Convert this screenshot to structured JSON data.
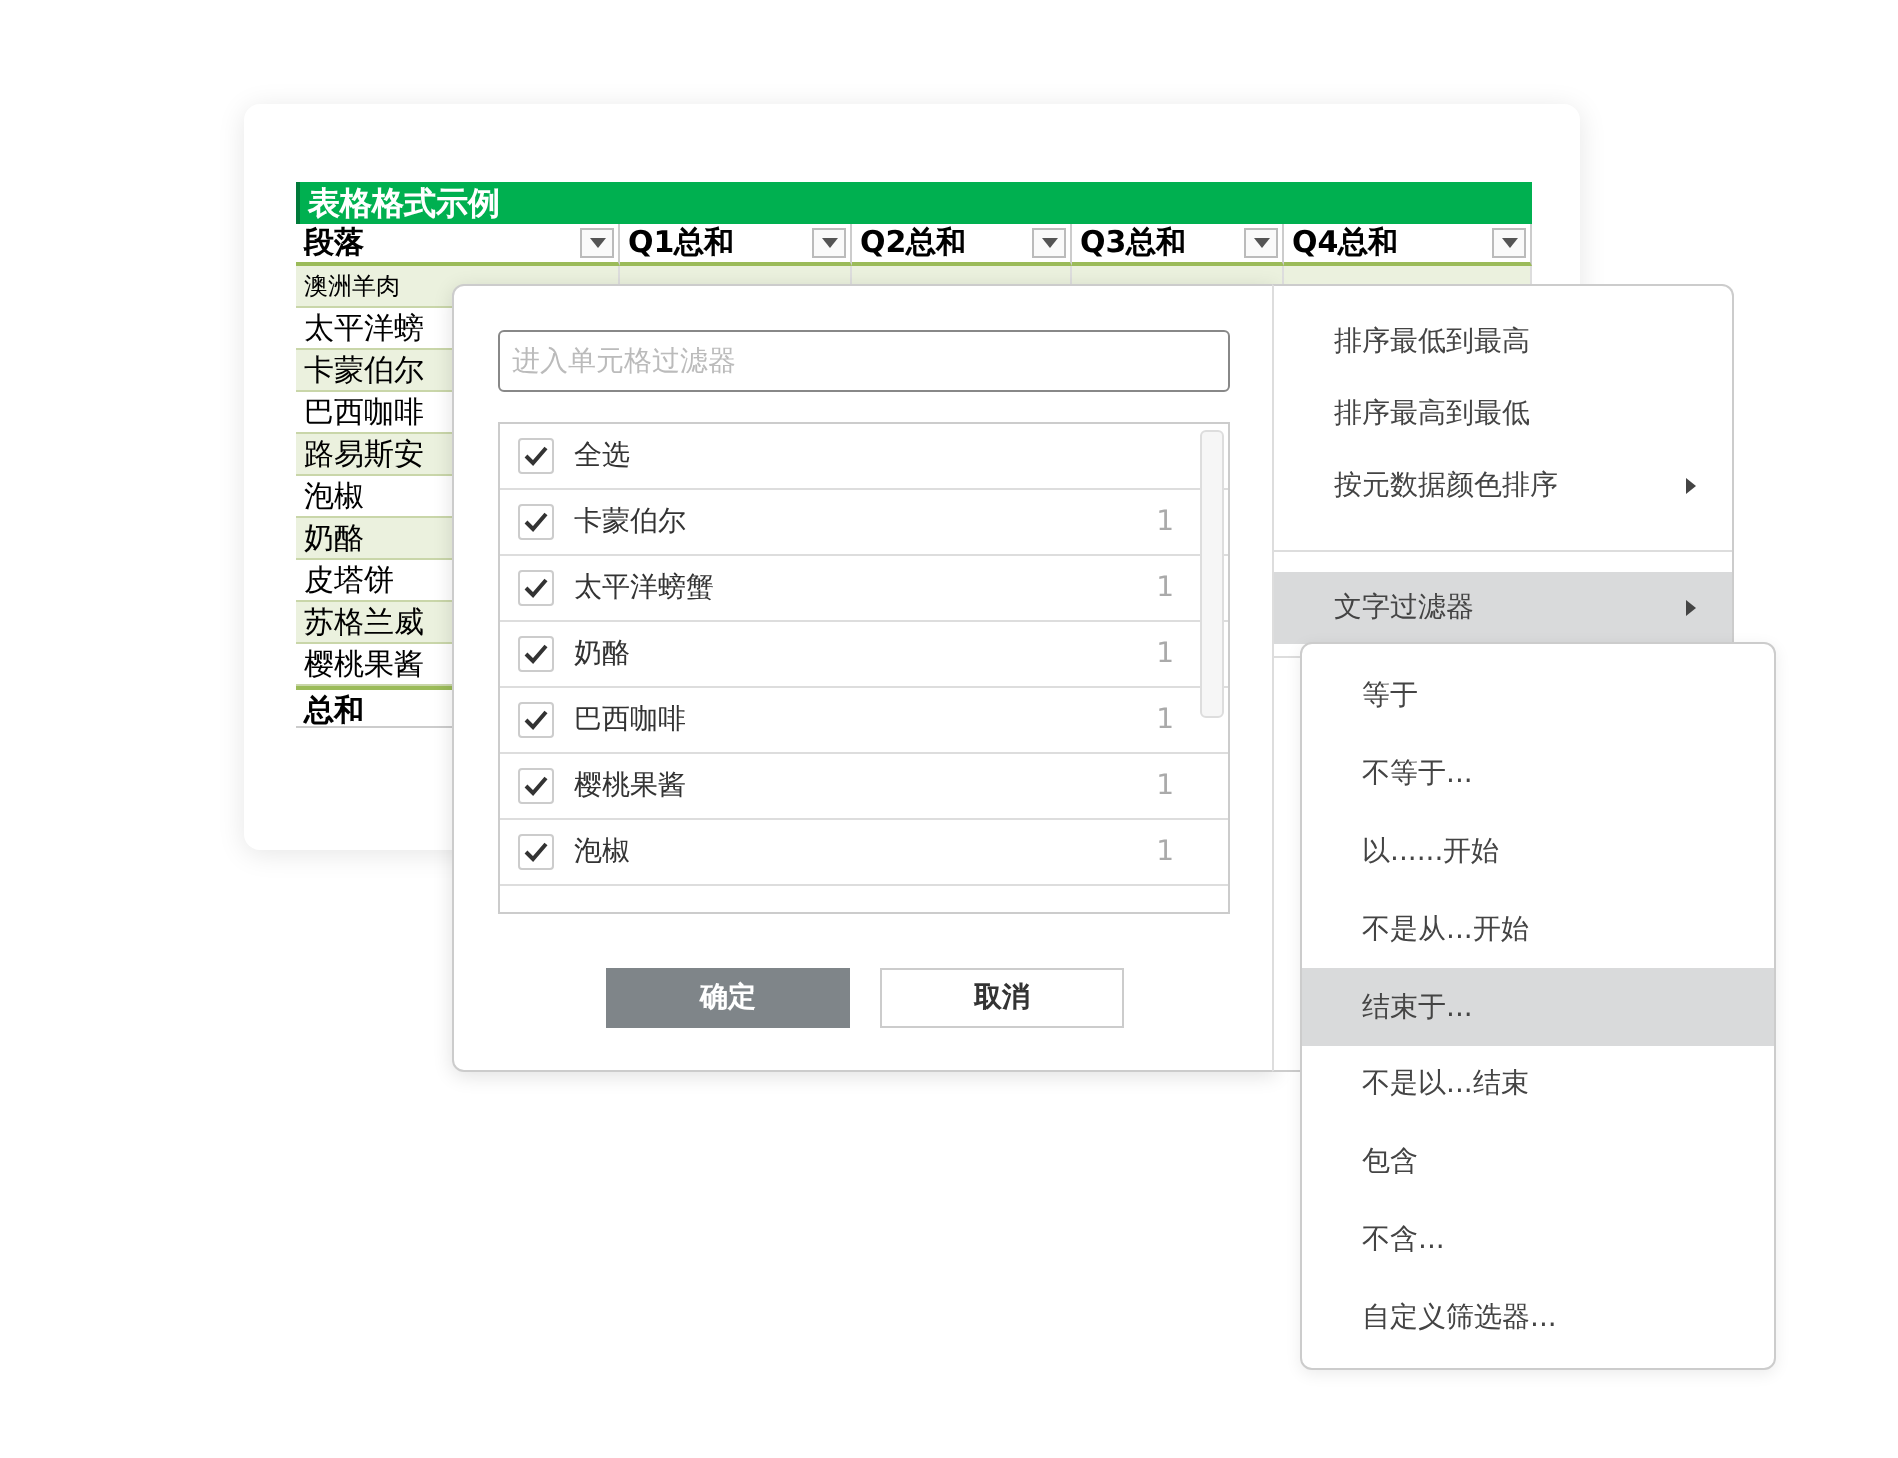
{
  "sheet": {
    "title": "表格格式示例",
    "columns": [
      "段落",
      "Q1总和",
      "Q2总和",
      "Q3总和",
      "Q4总和"
    ],
    "rows": [
      "澳洲羊肉",
      "太平洋螃",
      "卡蒙伯尔",
      "巴西咖啡",
      "路易斯安",
      "泡椒",
      "奶酪",
      "皮塔饼",
      "苏格兰威",
      "樱桃果酱"
    ],
    "total": "总和"
  },
  "filter": {
    "search": {
      "placeholder": "进入单元格过滤器"
    },
    "items": [
      {
        "label": "全选",
        "checked": true
      },
      {
        "label": "卡蒙伯尔",
        "count": "1",
        "checked": true
      },
      {
        "label": "太平洋螃蟹",
        "count": "1",
        "checked": true
      },
      {
        "label": "奶酪",
        "count": "1",
        "checked": true
      },
      {
        "label": "巴西咖啡",
        "count": "1",
        "checked": true
      },
      {
        "label": "樱桃果酱",
        "count": "1",
        "checked": true
      },
      {
        "label": "泡椒",
        "count": "1",
        "checked": true
      }
    ],
    "buttons": [
      {
        "label": "确定",
        "kind": "primary"
      },
      {
        "label": "取消",
        "kind": "secondary"
      }
    ]
  },
  "sort_menu": {
    "groups": [
      [
        {
          "label": "排序最低到最高",
          "submenu": false,
          "selected": false
        },
        {
          "label": "排序最高到最低",
          "submenu": false,
          "selected": false
        },
        {
          "label": "按元数据颜色排序",
          "submenu": true,
          "selected": false
        }
      ],
      [
        {
          "label": "文字过滤器",
          "submenu": true,
          "selected": true
        }
      ]
    ]
  },
  "text_filter_menu": {
    "items": [
      {
        "label": "等于",
        "selected": false
      },
      {
        "label": "不等于...",
        "selected": false
      },
      {
        "label": "以......开始",
        "selected": false
      },
      {
        "label": "不是从...开始",
        "selected": false
      },
      {
        "label": "结束于...",
        "selected": true
      },
      {
        "label": "不是以...结束",
        "selected": false
      },
      {
        "label": "包含",
        "selected": false
      },
      {
        "label": "不含...",
        "selected": false
      },
      {
        "label": "自定义筛选器...",
        "selected": false
      }
    ]
  }
}
